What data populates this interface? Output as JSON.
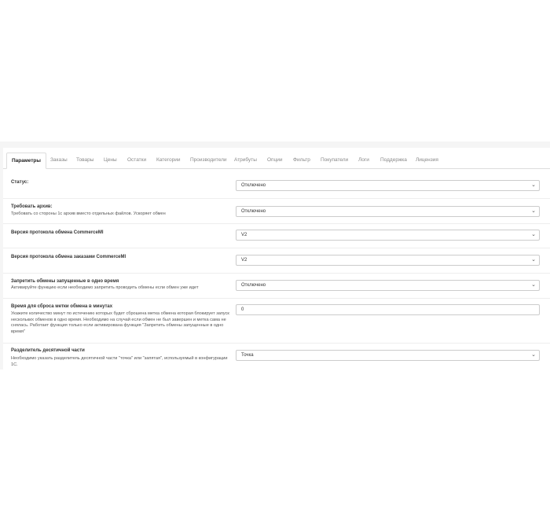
{
  "tabs": [
    {
      "label": "Параметры",
      "active": true
    },
    {
      "label": "Заказы"
    },
    {
      "label": "Товары"
    },
    {
      "label": "Цены"
    },
    {
      "label": "Остатки"
    },
    {
      "label": "Категории"
    },
    {
      "label": "Производители"
    },
    {
      "label": "Атрибуты"
    },
    {
      "label": "Опции"
    },
    {
      "label": "Фильтр"
    },
    {
      "label": "Покупатели"
    },
    {
      "label": "Логи"
    },
    {
      "label": "Поддержка"
    },
    {
      "label": "Лицензия"
    }
  ],
  "settings": {
    "status": {
      "label": "Статус:",
      "value": "Отключено"
    },
    "archive": {
      "label": "Требовать архив:",
      "help": "Требовать со стороны 1с архив вместо отдельных файлов. Ускоряет обмен",
      "value": "Отключено"
    },
    "protocol": {
      "label": "Версия протокола обмена CommerceMl",
      "value": "V2"
    },
    "orders_protocol": {
      "label": "Версия протокола обмена заказами CommerceMl",
      "value": "V2"
    },
    "block_concurrent": {
      "label": "Запретить обмены запущенные в одно время",
      "help": "Активируйте функцию если необходимо запретить проводить обмены если обмен уже идет",
      "value": "Отключено"
    },
    "reset_time": {
      "label": "Время для сброса метки обмена в минутах",
      "help": "Укажите количество минут по истечению которых будет сброшена метка обмена которая блокирует запуск нескольких обменов в одно время. Необходимо на случай если обмен не был завершен и метка сама не снялась. Работает функция только если активирована функция \"Запретить обмены запущенные в одно время\"",
      "value": "0"
    },
    "decimal": {
      "label": "Разделитель десятичной части",
      "help": "Необходимо указать разделитель десятичной части \"точка\" или \"запятая\", используемый в конфигурации 1С.",
      "value": "Точка"
    }
  },
  "icons": {
    "select_arrow": "chevron-down-icon"
  }
}
